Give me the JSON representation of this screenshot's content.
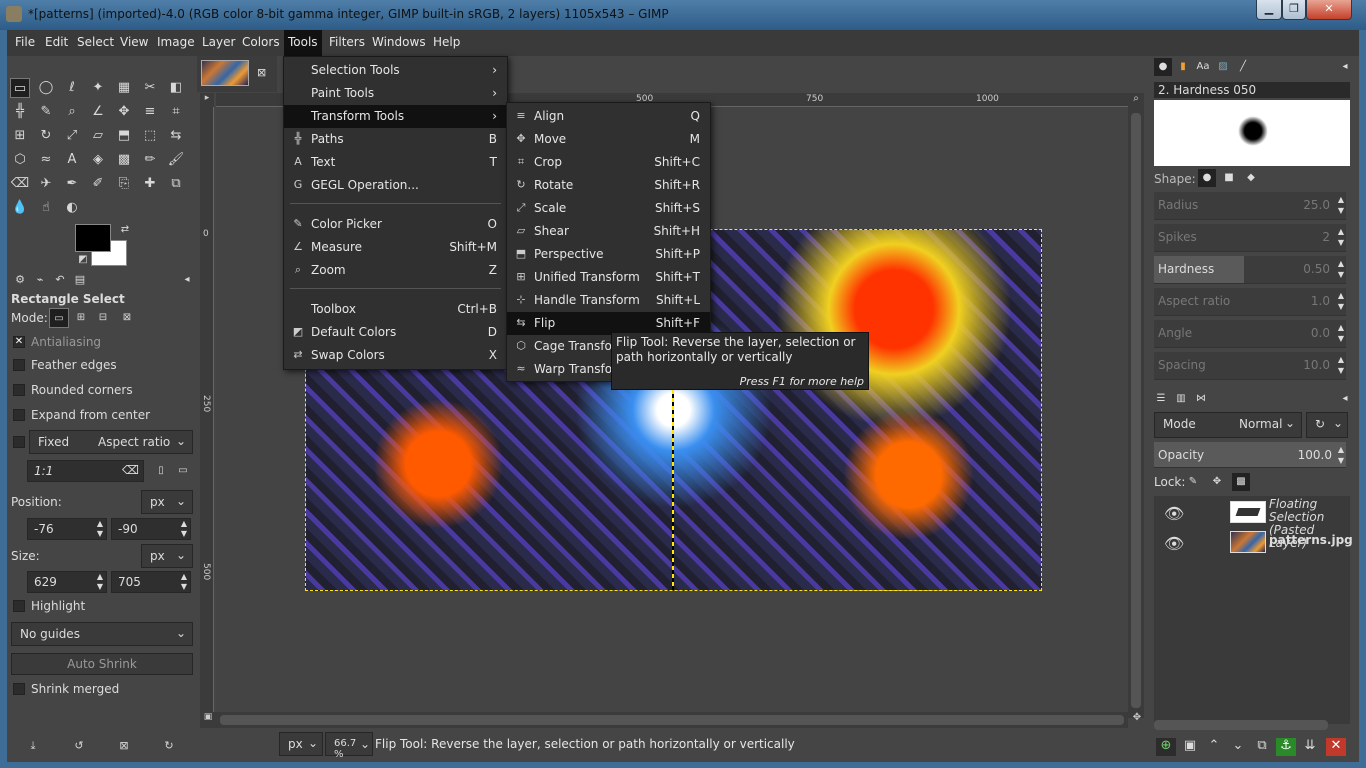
{
  "window": {
    "title": "*[patterns] (imported)-4.0 (RGB color 8-bit gamma integer, GIMP built-in sRGB, 2 layers) 1105x543 – GIMP",
    "min_label": "▁",
    "max_label": "❐",
    "close_label": "✕"
  },
  "menubar": [
    "File",
    "Edit",
    "Select",
    "View",
    "Image",
    "Layer",
    "Colors",
    "Tools",
    "Filters",
    "Windows",
    "Help"
  ],
  "tools_menu": {
    "items": [
      {
        "label": "Selection Tools",
        "shortcut": "›",
        "icon": ""
      },
      {
        "label": "Paint Tools",
        "shortcut": "›",
        "icon": ""
      },
      {
        "label": "Transform Tools",
        "shortcut": "›",
        "icon": ""
      },
      {
        "label": "Paths",
        "shortcut": "B",
        "icon": "╬"
      },
      {
        "label": "Text",
        "shortcut": "T",
        "icon": "A"
      },
      {
        "label": "GEGL Operation...",
        "shortcut": "",
        "icon": "G"
      },
      {
        "label": "Color Picker",
        "shortcut": "O",
        "icon": "✎"
      },
      {
        "label": "Measure",
        "shortcut": "Shift+M",
        "icon": "∠"
      },
      {
        "label": "Zoom",
        "shortcut": "Z",
        "icon": "⌕"
      },
      {
        "label": "Toolbox",
        "shortcut": "Ctrl+B",
        "icon": ""
      },
      {
        "label": "Default Colors",
        "shortcut": "D",
        "icon": "◩"
      },
      {
        "label": "Swap Colors",
        "shortcut": "X",
        "icon": "⇄"
      }
    ]
  },
  "transform_menu": {
    "items": [
      {
        "label": "Align",
        "shortcut": "Q",
        "icon": "≡"
      },
      {
        "label": "Move",
        "shortcut": "M",
        "icon": "✥"
      },
      {
        "label": "Crop",
        "shortcut": "Shift+C",
        "icon": "⌗"
      },
      {
        "label": "Rotate",
        "shortcut": "Shift+R",
        "icon": "↻"
      },
      {
        "label": "Scale",
        "shortcut": "Shift+S",
        "icon": "⤢"
      },
      {
        "label": "Shear",
        "shortcut": "Shift+H",
        "icon": "▱"
      },
      {
        "label": "Perspective",
        "shortcut": "Shift+P",
        "icon": "⬒"
      },
      {
        "label": "Unified Transform",
        "shortcut": "Shift+T",
        "icon": "⊞"
      },
      {
        "label": "Handle Transform",
        "shortcut": "Shift+L",
        "icon": "⊹"
      },
      {
        "label": "Flip",
        "shortcut": "Shift+F",
        "icon": "⇆"
      },
      {
        "label": "Cage Transform",
        "shortcut": "",
        "icon": "⬡"
      },
      {
        "label": "Warp Transform",
        "shortcut": "",
        "icon": "≈"
      }
    ]
  },
  "tooltip": {
    "text": "Flip Tool: Reverse the layer, selection or path horizontally or vertically",
    "help": "Press F1 for more help"
  },
  "tool_options": {
    "title": "Rectangle Select",
    "mode_label": "Mode:",
    "antialiasing": "Antialiasing",
    "feather_edges": "Feather edges",
    "rounded_corners": "Rounded corners",
    "expand_from_center": "Expand from center",
    "fixed": "Fixed",
    "fixed_option": "Aspect ratio",
    "ratio_value": "1:1",
    "position_label": "Position:",
    "position_unit": "px",
    "position_x": "-76",
    "position_y": "-90",
    "size_label": "Size:",
    "size_unit": "px",
    "size_w": "629",
    "size_h": "705",
    "highlight": "Highlight",
    "guides": "No guides",
    "auto_shrink": "Auto Shrink",
    "shrink_merged": "Shrink merged"
  },
  "rulers": {
    "h": [
      "500",
      "750",
      "1000"
    ],
    "v": [
      "0",
      "250",
      "500"
    ]
  },
  "statusbar": {
    "unit": "px",
    "zoom": "66.7 %",
    "message": "Flip Tool: Reverse the layer, selection or path horizontally or vertically"
  },
  "brushes": {
    "name": "2. Hardness 050",
    "shape_label": "Shape:",
    "sliders": [
      {
        "label": "Radius",
        "value": "25.0"
      },
      {
        "label": "Spikes",
        "value": "2"
      },
      {
        "label": "Hardness",
        "value": "0.50"
      },
      {
        "label": "Aspect ratio",
        "value": "1.0"
      },
      {
        "label": "Angle",
        "value": "0.0"
      },
      {
        "label": "Spacing",
        "value": "10.0"
      }
    ]
  },
  "layers": {
    "mode_label": "Mode",
    "mode_value": "Normal",
    "opacity_label": "Opacity",
    "opacity_value": "100.0",
    "lock_label": "Lock:",
    "items": [
      {
        "name": "Floating Selection",
        "sub": "(Pasted Layer)"
      },
      {
        "name": "patterns.jpg",
        "sub": ""
      }
    ]
  },
  "colors": {
    "menu_bg": "#303030",
    "highlight": "#111111",
    "selection_outline": "#ffea00",
    "title_blue": "#3e6d98"
  }
}
